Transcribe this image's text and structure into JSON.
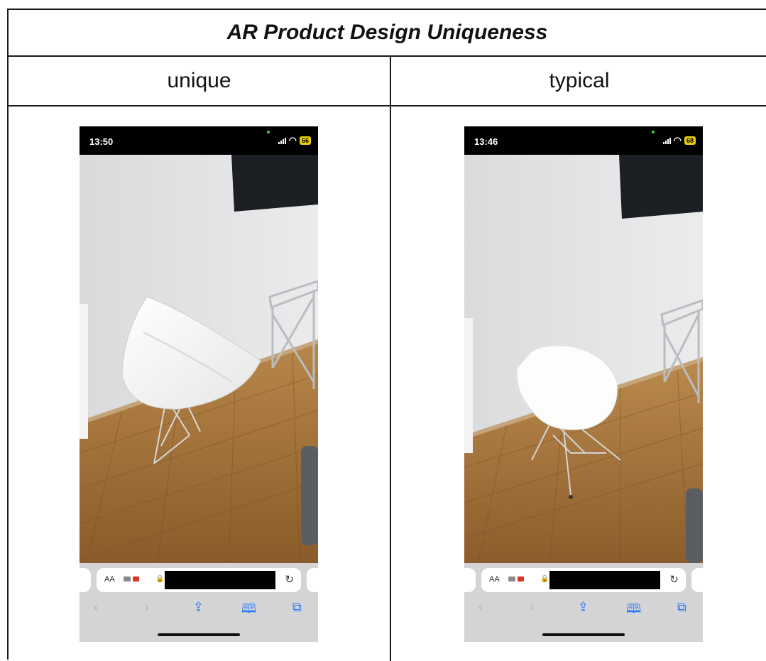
{
  "table": {
    "title": "AR Product Design Uniqueness",
    "columns": [
      {
        "header": "unique",
        "screenshot": {
          "status_time": "13:50",
          "battery": "66",
          "browser": {
            "text_size_label": "AA",
            "reload_icon": "reload-icon",
            "nav_icons": [
              "back-icon",
              "forward-icon",
              "share-icon",
              "bookmarks-icon",
              "tabs-icon"
            ]
          },
          "scene_object": "triangular-shell-chair"
        }
      },
      {
        "header": "typical",
        "screenshot": {
          "status_time": "13:46",
          "battery": "68",
          "browser": {
            "text_size_label": "AA",
            "reload_icon": "reload-icon",
            "nav_icons": [
              "back-icon",
              "forward-icon",
              "share-icon",
              "bookmarks-icon",
              "tabs-icon"
            ]
          },
          "scene_object": "molded-eiffel-chair"
        }
      }
    ]
  },
  "colors": {
    "border": "#1a1a1a",
    "status_bar": "#000000",
    "battery": "#e6d000",
    "browser_toolbar": "#d4d4d6",
    "accent_blue": "#2f7cf6",
    "record_red": "#e0312b"
  }
}
